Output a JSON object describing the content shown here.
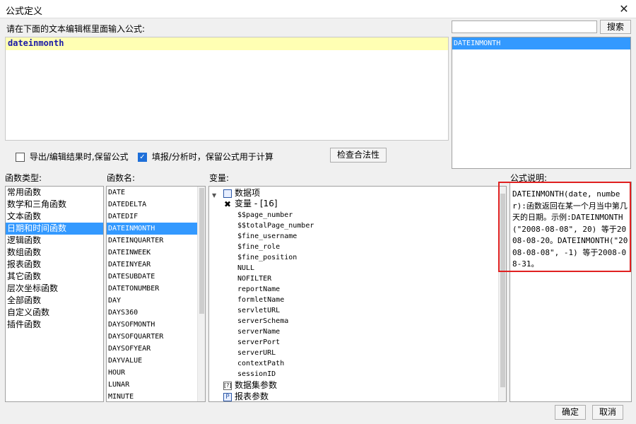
{
  "window": {
    "title": "公式定义",
    "close_glyph": "✕"
  },
  "editor": {
    "label": "请在下面的文本编辑框里面输入公式:",
    "value": "dateinmonth"
  },
  "search": {
    "value": "",
    "button": "搜索",
    "results": [
      "DATEINMONTH"
    ]
  },
  "options": {
    "keep_formula_export": {
      "label": "导出/编辑结果时,保留公式",
      "checked": false
    },
    "keep_formula_fill": {
      "label": "填报/分析时，保留公式用于计算",
      "checked": true
    },
    "validate_button": "检查合法性"
  },
  "categories": {
    "label": "函数类型:",
    "items": [
      "常用函数",
      "数学和三角函数",
      "文本函数",
      "日期和时间函数",
      "逻辑函数",
      "数组函数",
      "报表函数",
      "其它函数",
      "层次坐标函数",
      "全部函数",
      "自定义函数",
      "插件函数"
    ],
    "selected_index": 3
  },
  "functions": {
    "label": "函数名:",
    "items": [
      "DATE",
      "DATEDELTA",
      "DATEDIF",
      "DATEINMONTH",
      "DATEINQUARTER",
      "DATEINWEEK",
      "DATEINYEAR",
      "DATESUBDATE",
      "DATETONUMBER",
      "DAY",
      "DAYS360",
      "DAYSOFMONTH",
      "DAYSOFQUARTER",
      "DAYSOFYEAR",
      "DAYVALUE",
      "HOUR",
      "LUNAR",
      "MINUTE"
    ],
    "selected_index": 3
  },
  "variables": {
    "label": "变量:",
    "data_item": "数据项",
    "var_group": "变量 - [16]",
    "var_items": [
      "$$page_number",
      "$$totalPage_number",
      "$fine_username",
      "$fine_role",
      "$fine_position",
      "NULL",
      "NOFILTER",
      "reportName",
      "formletName",
      "servletURL",
      "serverSchema",
      "serverName",
      "serverPort",
      "serverURL",
      "contextPath",
      "sessionID"
    ],
    "dataset_params": "数据集参数",
    "report_params": "报表参数"
  },
  "description": {
    "label": "公式说明:",
    "text": "DATEINMONTH(date, number):函数返回在某一个月当中第几天的日期。示例:DATEINMONTH(\"2008-08-08\", 20) 等于2008-08-20。DATEINMONTH(\"2008-08-08\", -1) 等于2008-08-31。"
  },
  "footer": {
    "ok": "确定",
    "cancel": "取消"
  }
}
